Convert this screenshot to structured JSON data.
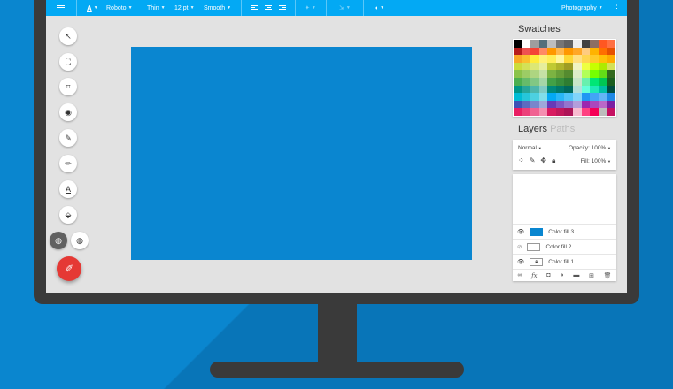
{
  "toolbar": {
    "font_family": "Roboto",
    "font_weight": "Thin",
    "font_size": "12 pt",
    "antialias": "Smooth",
    "workspace": "Photography",
    "text_color_letter": "A"
  },
  "tools": [
    "select",
    "transform",
    "crop",
    "view",
    "brush",
    "pencil",
    "text",
    "fill"
  ],
  "swatches": {
    "title": "Swatches",
    "colors": [
      [
        "#000000",
        "#ffffff",
        "#9e9e9e",
        "#546e7a",
        "#bdbdbd",
        "#757575",
        "#616161",
        "#eeeeee",
        "#424242",
        "#8d6e63",
        "#ff5722",
        "#ff7043"
      ],
      [
        "#b71c1c",
        "#ef5350",
        "#f44336",
        "#ff8a65",
        "#ff9800",
        "#ffb74d",
        "#ff9800",
        "#ffa726",
        "#ffcc80",
        "#ffb300",
        "#ff6f00",
        "#e65100"
      ],
      [
        "#f9a825",
        "#fbc02d",
        "#ffeb3b",
        "#fff176",
        "#ffee58",
        "#fff59d",
        "#fdd835",
        "#ffe082",
        "#ffd54f",
        "#ffca28",
        "#ffc107",
        "#ffab00"
      ],
      [
        "#cddc39",
        "#d4e157",
        "#dce775",
        "#e6ee9c",
        "#c0ca33",
        "#afb42b",
        "#9e9d24",
        "#f0f4c3",
        "#eeff41",
        "#c6ff00",
        "#aeea00",
        "#d4e157"
      ],
      [
        "#8bc34a",
        "#9ccc65",
        "#aed581",
        "#c5e1a5",
        "#7cb342",
        "#689f38",
        "#558b2f",
        "#dcedc8",
        "#b2ff59",
        "#76ff03",
        "#64dd17",
        "#33691e"
      ],
      [
        "#4caf50",
        "#66bb6a",
        "#81c784",
        "#a5d6a7",
        "#43a047",
        "#388e3c",
        "#2e7d32",
        "#c8e6c9",
        "#69f0ae",
        "#00e676",
        "#00c853",
        "#1b5e20"
      ],
      [
        "#009688",
        "#26a69a",
        "#4db6ac",
        "#80cbc4",
        "#00897b",
        "#00796b",
        "#00695c",
        "#b2dfdb",
        "#64ffda",
        "#1de9b6",
        "#00bfa5",
        "#004d40"
      ],
      [
        "#00bcd4",
        "#26c6da",
        "#4dd0e1",
        "#80deea",
        "#03a9f4",
        "#29b6f6",
        "#4fc3f7",
        "#81d4fa",
        "#2196f3",
        "#42a5f5",
        "#64b5f6",
        "#1e88e5"
      ],
      [
        "#3f51b5",
        "#5c6bc0",
        "#7986cb",
        "#9fa8da",
        "#673ab7",
        "#7e57c2",
        "#9575cd",
        "#b39ddb",
        "#9c27b0",
        "#ab47bc",
        "#ba68c8",
        "#7b1fa2"
      ],
      [
        "#e91e63",
        "#ec407a",
        "#f06292",
        "#f48fb1",
        "#d81b60",
        "#c2185b",
        "#ad1457",
        "#f8bbd0",
        "#ff4081",
        "#f50057",
        "#bdbdbd",
        "#c51162"
      ]
    ]
  },
  "layers": {
    "title": "Layers",
    "tab_inactive": "Paths",
    "blend_mode": "Normal",
    "opacity_label": "Opacity:",
    "opacity_value": "100%",
    "fill_label": "Fill:",
    "fill_value": "100%",
    "items": [
      {
        "name": "Color fill 3",
        "thumb_color": "#0a86d0",
        "visible": true
      },
      {
        "name": "Color fill 2",
        "thumb_color": "#ffffff",
        "visible": false
      },
      {
        "name": "Color fill 1",
        "thumb_color": "#ffffff",
        "visible": true,
        "locked": true
      }
    ]
  },
  "colors": {
    "background": "#0a86cf",
    "toolbar": "#03a9f4",
    "canvas_fill": "#0a86d0",
    "fab": "#e53935"
  }
}
